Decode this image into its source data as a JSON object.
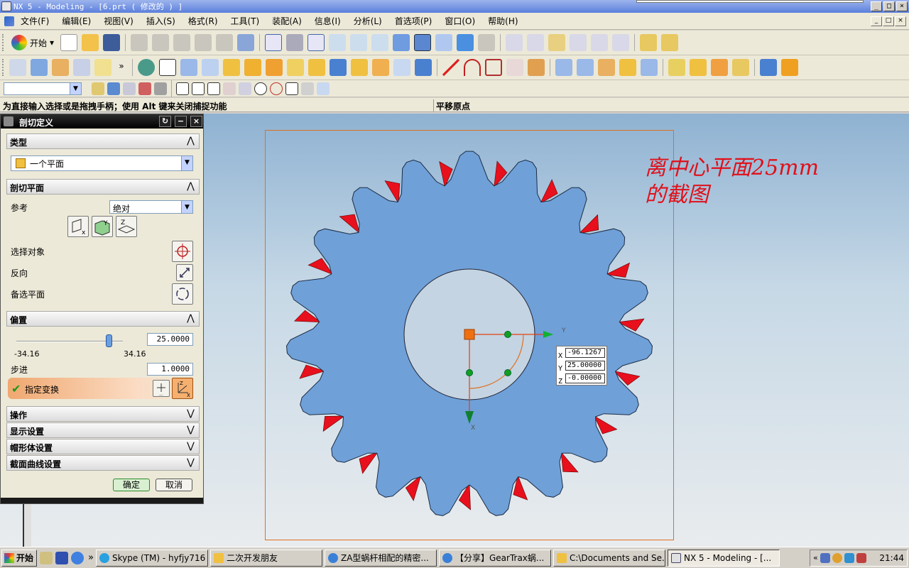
{
  "window": {
    "title": "NX 5 - Modeling - [6.prt ( 修改的 ) ]",
    "min_glyph": "_",
    "max_glyph": "□",
    "close_glyph": "×"
  },
  "menu": {
    "items": [
      "文件(F)",
      "编辑(E)",
      "视图(V)",
      "插入(S)",
      "格式(R)",
      "工具(T)",
      "装配(A)",
      "信息(I)",
      "分析(L)",
      "首选项(P)",
      "窗口(O)",
      "帮助(H)"
    ]
  },
  "toolbar": {
    "start_label": "开始",
    "more_glyph": "»"
  },
  "status": {
    "prompt": "为直接输入选择或是拖拽手柄；使用 Alt 键来关闭捕捉功能",
    "message": "平移原点"
  },
  "dialog": {
    "title": "剖切定义",
    "sections": {
      "type": "类型",
      "plane": "剖切平面",
      "offset": "偏置",
      "operation": "操作",
      "display": "显示设置",
      "cap": "帽形体设置",
      "curves": "截面曲线设置"
    },
    "type_value": "一个平面",
    "reference_label": "参考",
    "reference_value": "绝对",
    "select_object_label": "选择对象",
    "reverse_label": "反向",
    "alternate_plane_label": "备选平面",
    "offset_value": "25.0000",
    "offset_fraction": 0.866,
    "slider_min": "-34.16",
    "slider_max": "34.16",
    "step_label": "步进",
    "step_value": "1.0000",
    "specify_transform_label": "指定变换",
    "ok_label": "确定",
    "cancel_label": "取消"
  },
  "viewport": {
    "annotation_line1": "离中心平面25mm",
    "annotation_line2": "的截图",
    "axis_y_label": "Y",
    "axis_x_label": "X",
    "coords": [
      {
        "label": "X",
        "value": "-96.1267"
      },
      {
        "label": "Y",
        "value": "25.00000"
      },
      {
        "label": "Z",
        "value": "-0.00000"
      }
    ],
    "gear_color": "#6fa0d8",
    "cut_color": "#e8101c",
    "handle_color": "#f07010"
  },
  "taskbar": {
    "start_label": "开始",
    "more_glyph": "»",
    "tasks": [
      {
        "label": "Skype (TM) - hyfjy716"
      },
      {
        "label": "二次开发朋友"
      },
      {
        "label": "ZA型蜗杆相配的精密..."
      },
      {
        "label": "【分享】GearTrax蜗..."
      },
      {
        "label": "C:\\Documents and Se..."
      },
      {
        "label": "NX 5 - Modeling - [..."
      }
    ],
    "tray_glyph": "«",
    "clock": "21:44"
  }
}
